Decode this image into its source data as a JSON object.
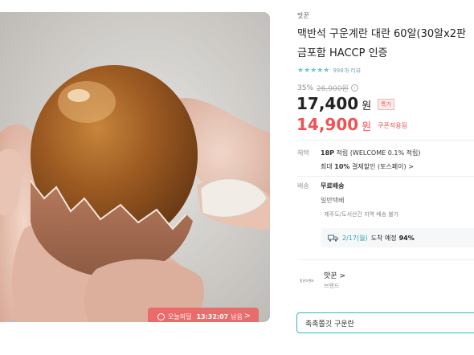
{
  "deal": {
    "label": "오늘의딜",
    "timer": "13:32:07",
    "timer_suffix": "남음",
    "arrow": ">"
  },
  "product": {
    "seller": "맛꾼",
    "title_line1": "맥반석 구운계란 대란 60알(30알x2판",
    "title_line2": "금포함 HACCP 인증",
    "stars": "★★★★★",
    "review_count": "998개 리뷰",
    "rating_value": 5,
    "discount_pct": "35%",
    "original_price": "26,900원",
    "price": "17,400",
    "price_unit": "원",
    "special_badge": "특가",
    "coupon_price": "14,900",
    "coupon_unit": "원",
    "coupon_label": "쿠폰적용됨"
  },
  "benefits": {
    "label": "혜택",
    "points_bold": "18P",
    "points_text": " 적립 (WELCOME 0.1% 적립)",
    "card_prefix": "최대 ",
    "card_bold": "10%",
    "card_text": " 결제할인 (토스페이)",
    "card_arrow": ">"
  },
  "shipping": {
    "label": "배송",
    "fee": "무료배송",
    "type": "일반택배",
    "island": "제주도/도서산간 지역 배송 불가",
    "eta_date": "2/17(월)",
    "eta_text": "도착 예정",
    "eta_pct": "94%"
  },
  "brand": {
    "logo_text": "맛꾼브랜드",
    "name": "맛꾼",
    "arrow": ">",
    "sub": "브랜드"
  },
  "coupon_button": {
    "label": "촉촉쫄깃 구운란"
  },
  "colors": {
    "accent": "#36b6c4",
    "coupon_red": "#f05252",
    "deal_badge": "#ec6262"
  }
}
